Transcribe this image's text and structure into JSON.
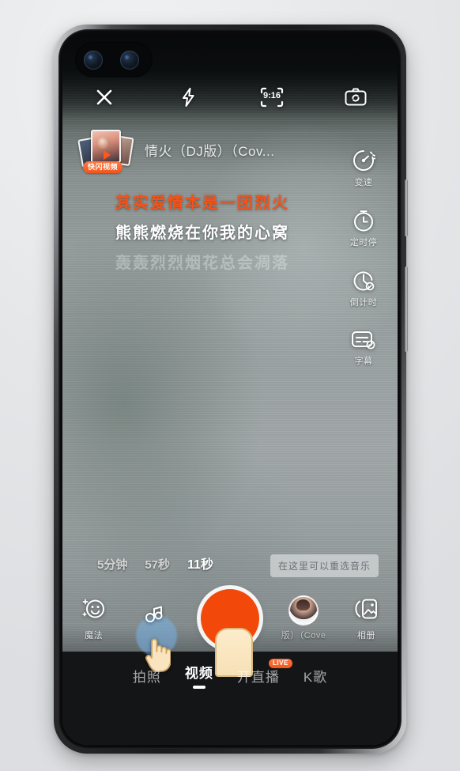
{
  "app": {
    "name": "kuaishou-camera",
    "accent_orange": "#f2541a",
    "record_color": "#f2490a",
    "badge_orange": "#f2551a"
  },
  "topbar": {
    "close_icon": "close-icon",
    "flash_icon": "flash-icon",
    "ratio_label": "9:16",
    "ratio_icon": "aspect-ratio-icon",
    "flip_icon": "camera-flip-icon"
  },
  "song": {
    "title": "情火（DJ版）（Cov...",
    "thumb_badge": "快闪视频",
    "thumb_icon": "photo-stack-icon"
  },
  "lyrics": [
    {
      "text": "其实爱情本是一团烈火",
      "state": "active"
    },
    {
      "text": "熊熊燃烧在你我的心窝",
      "state": "next"
    },
    {
      "text": "轰轰烈烈烟花总会凋落",
      "state": "dim"
    }
  ],
  "sidebar": {
    "items": [
      {
        "label": "变速",
        "icon": "speed-gauge-icon"
      },
      {
        "label": "定时停",
        "icon": "timer-stop-icon"
      },
      {
        "label": "倒计时",
        "icon": "countdown-icon"
      },
      {
        "label": "字幕",
        "icon": "subtitle-icon"
      }
    ]
  },
  "durations": [
    {
      "label": "5分钟",
      "selected": false
    },
    {
      "label": "57秒",
      "selected": false
    },
    {
      "label": "11秒",
      "selected": true
    }
  ],
  "tooltip": {
    "text": "在这里可以重选音乐"
  },
  "controls": {
    "magic": {
      "label": "魔法",
      "icon": "magic-face-icon"
    },
    "music": {
      "label": "",
      "icon": "music-note-icon",
      "cursor": "hand-pointer-icon"
    },
    "record": {
      "label": "",
      "icon": "record-button"
    },
    "music_pick": {
      "label": "版）（Cove",
      "icon": "music-avatar"
    },
    "album": {
      "label": "相册",
      "icon": "album-stack-icon"
    }
  },
  "tabs": [
    {
      "label": "拍照",
      "active": false,
      "badge": ""
    },
    {
      "label": "视频",
      "active": true,
      "badge": ""
    },
    {
      "label": "开直播",
      "active": false,
      "badge": "LIVE"
    },
    {
      "label": "K歌",
      "active": false,
      "badge": ""
    }
  ]
}
